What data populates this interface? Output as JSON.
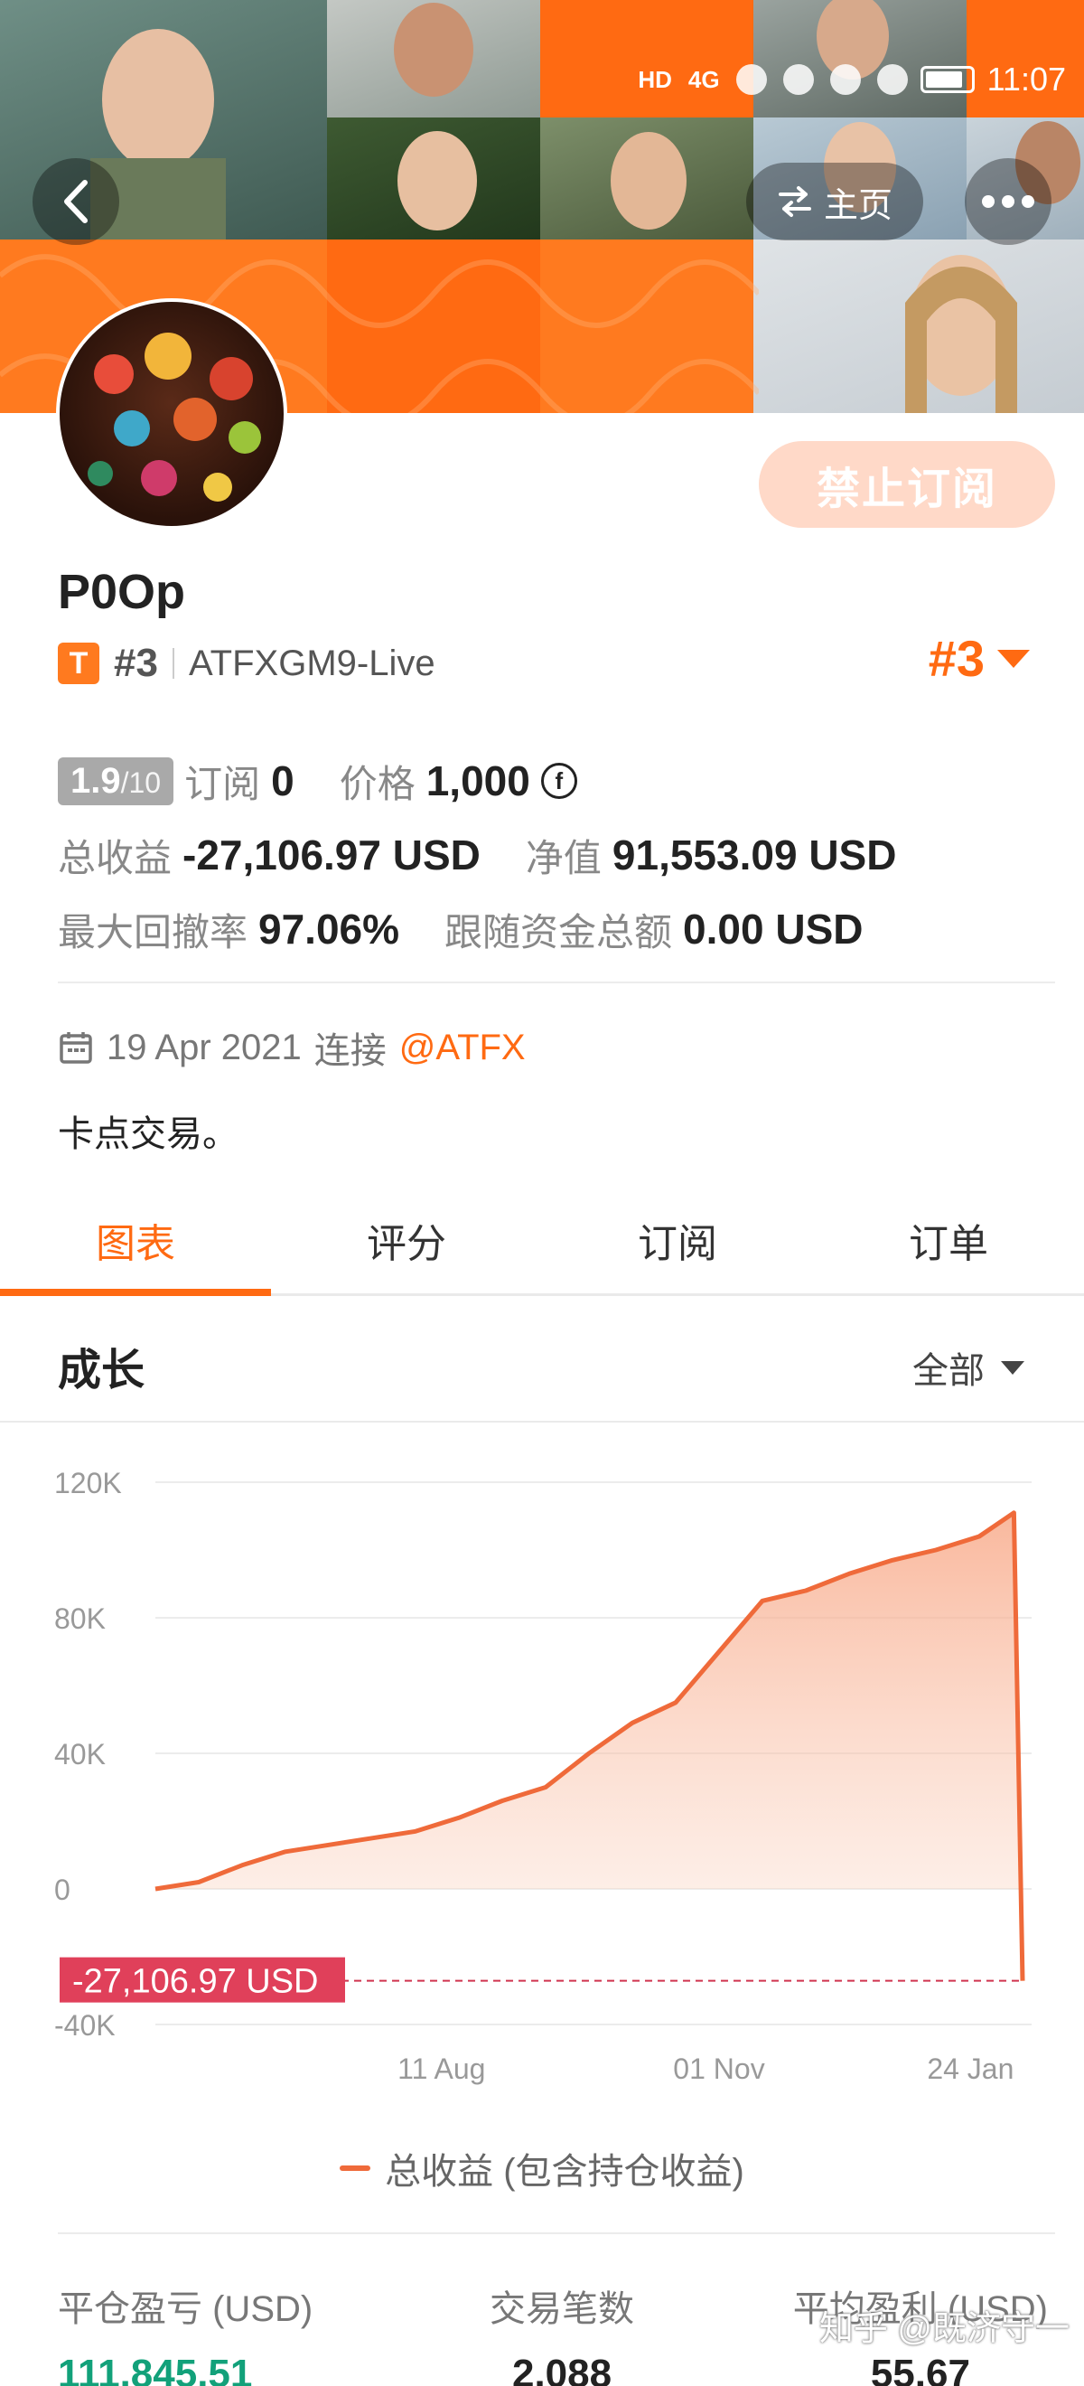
{
  "status_bar": {
    "time": "11:07",
    "network": "4G",
    "hd_label": "HD"
  },
  "header": {
    "home_label": "主页",
    "ban_button": "禁止订阅"
  },
  "profile": {
    "name": "P0Op",
    "badge": "T",
    "rank_small": "#3",
    "server": "ATFXGM9-Live",
    "rank_big": "#3"
  },
  "stats": {
    "score": "1.9",
    "score_max": "/10",
    "subscriptions_label": "订阅",
    "subscriptions_value": "0",
    "price_label": "价格",
    "price_value": "1,000",
    "coin_symbol": "f",
    "total_profit_label": "总收益",
    "total_profit_value": "-27,106.97 USD",
    "equity_label": "净值",
    "equity_value": "91,553.09 USD",
    "max_drawdown_label": "最大回撤率",
    "max_drawdown_value": "97.06%",
    "follow_funds_label": "跟随资金总额",
    "follow_funds_value": "0.00 USD"
  },
  "join": {
    "date": "19 Apr 2021",
    "connect_label": "连接",
    "broker": "@ATFX"
  },
  "bio": "卡点交易。",
  "tabs": [
    {
      "label": "图表",
      "active": true
    },
    {
      "label": "评分",
      "active": false
    },
    {
      "label": "订阅",
      "active": false
    },
    {
      "label": "订单",
      "active": false
    }
  ],
  "section": {
    "title": "成长",
    "range": "全部"
  },
  "chart_data": {
    "type": "area",
    "title": "",
    "ylim": [
      -40000,
      120000
    ],
    "y_ticks": [
      "120K",
      "80K",
      "40K",
      "0",
      "-40K"
    ],
    "x_ticks": [
      "11 Aug",
      "01 Nov",
      "24 Jan"
    ],
    "series": [
      {
        "name": "总收益 (包含持仓收益)",
        "color": "#ef6a3a",
        "x": [
          0,
          0.05,
          0.1,
          0.15,
          0.2,
          0.25,
          0.3,
          0.35,
          0.4,
          0.45,
          0.5,
          0.55,
          0.6,
          0.65,
          0.7,
          0.75,
          0.8,
          0.85,
          0.9,
          0.95,
          0.99,
          1.0
        ],
        "values": [
          0,
          2000,
          7000,
          11000,
          13000,
          15000,
          17000,
          21000,
          26000,
          30000,
          40000,
          49000,
          55000,
          70000,
          85000,
          88000,
          93000,
          97000,
          100000,
          104000,
          111000,
          -27106.97
        ]
      }
    ],
    "marker_label": "-27,106.97 USD",
    "marker_value": -27106.97
  },
  "legend_label": "总收益 (包含持仓收益)",
  "footer": {
    "closed_pl_label": "平仓盈亏 (USD)",
    "closed_pl_value": "111,845.51",
    "trades_label": "交易笔数",
    "trades_value": "2,088",
    "avg_profit_label": "平均盈利 (USD)",
    "avg_profit_value": "55.67"
  },
  "watermark": "知乎 @既济守一"
}
